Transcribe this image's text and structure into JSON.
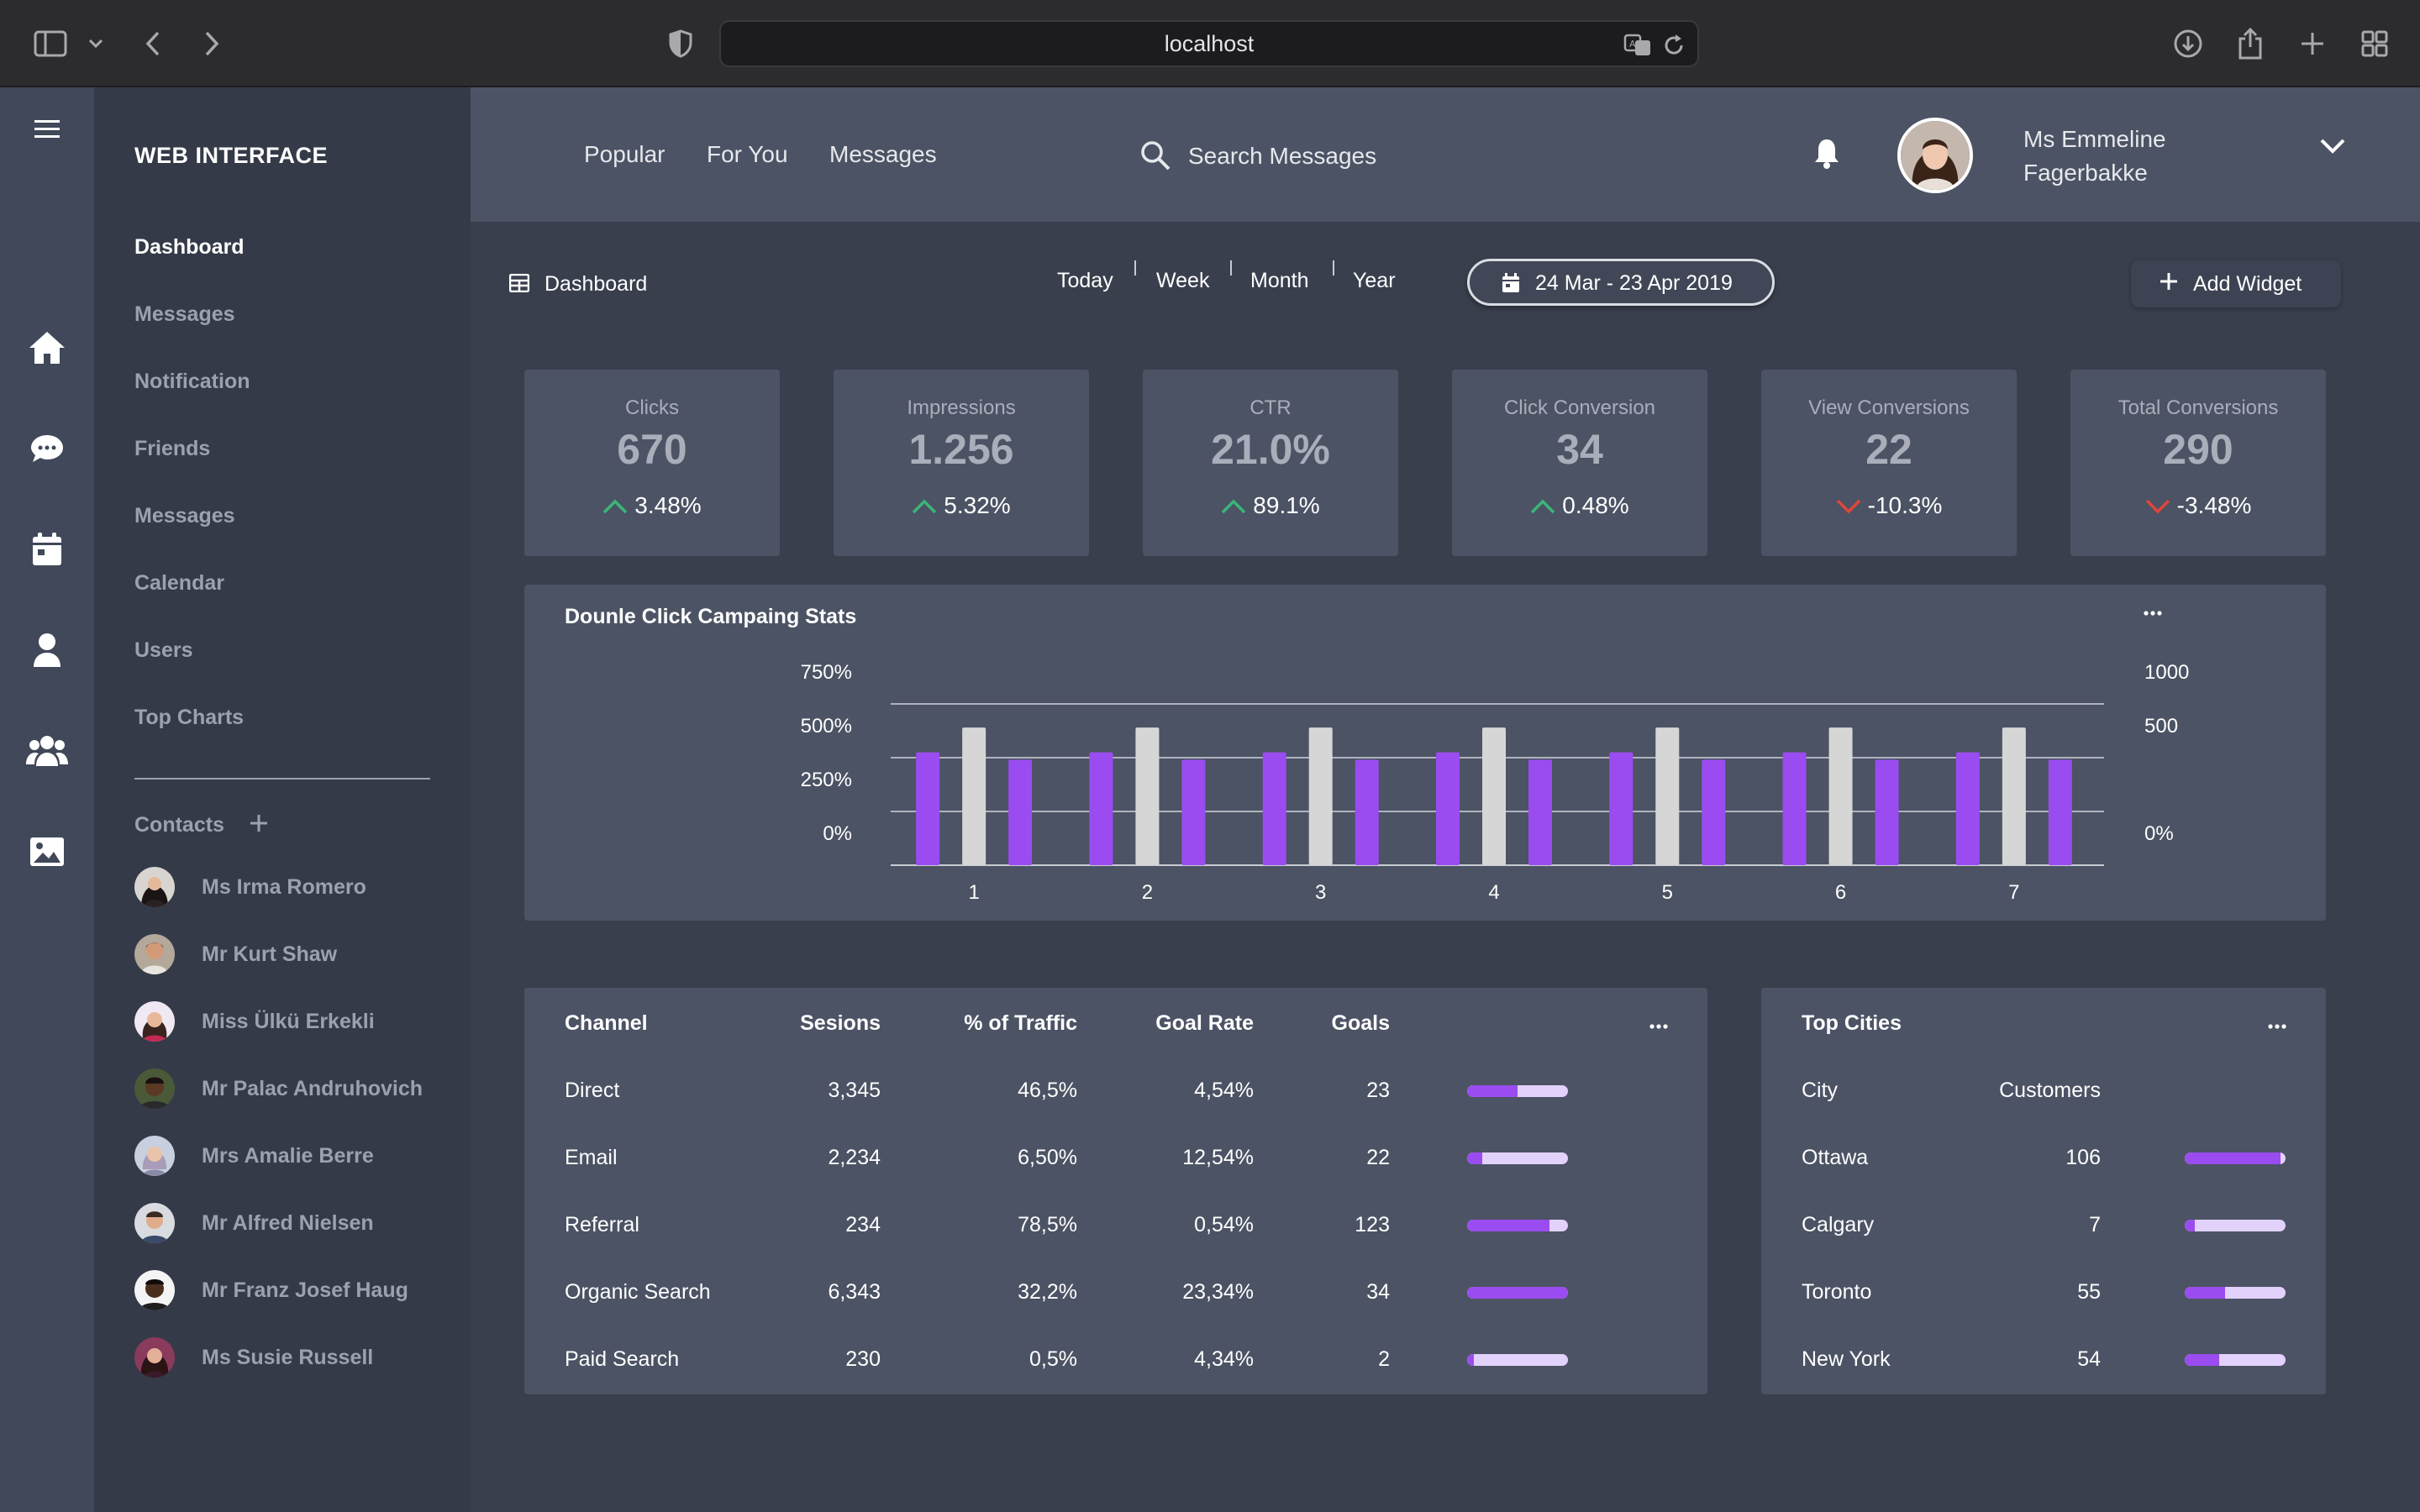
{
  "browser": {
    "url": "localhost"
  },
  "sidebar": {
    "brand": "WEB INTERFACE",
    "items": [
      {
        "label": "Dashboard",
        "active": true
      },
      {
        "label": "Messages"
      },
      {
        "label": "Notification"
      },
      {
        "label": "Friends"
      },
      {
        "label": "Messages"
      },
      {
        "label": "Calendar"
      },
      {
        "label": "Users"
      },
      {
        "label": "Top Charts"
      }
    ],
    "contacts_label": "Contacts",
    "contacts": [
      {
        "name": "Ms Irma Romero"
      },
      {
        "name": "Mr Kurt Shaw"
      },
      {
        "name": "Miss Ülkü Erkekli"
      },
      {
        "name": "Mr Palac Andruhovich"
      },
      {
        "name": "Mrs Amalie Berre"
      },
      {
        "name": "Mr Alfred Nielsen"
      },
      {
        "name": "Mr Franz Josef Haug"
      },
      {
        "name": "Ms Susie Russell"
      }
    ]
  },
  "rail_icons": [
    "home-icon",
    "chat-icon",
    "calendar-icon",
    "user-icon",
    "users-icon",
    "image-icon"
  ],
  "topbar": {
    "nav": [
      "Popular",
      "For You",
      "Messages"
    ],
    "search_placeholder": "Search Messages",
    "user": {
      "name_line1": "Ms Emmeline",
      "name_line2": "Fagerbakke"
    }
  },
  "dashboard": {
    "title": "Dashboard",
    "periods": [
      "Today",
      "Week",
      "Month",
      "Year"
    ],
    "date_range": "24 Mar - 23 Apr 2019",
    "add_widget": "Add Widget"
  },
  "kpis": [
    {
      "label": "Clicks",
      "value": "670",
      "change": "3.48%",
      "trend": "up"
    },
    {
      "label": "Impressions",
      "value": "1.256",
      "change": "5.32%",
      "trend": "up"
    },
    {
      "label": "CTR",
      "value": "21.0%",
      "change": "89.1%",
      "trend": "up"
    },
    {
      "label": "Click Conversion",
      "value": "34",
      "change": "0.48%",
      "trend": "up"
    },
    {
      "label": "View Conversions",
      "value": "22",
      "change": "-10.3%",
      "trend": "down"
    },
    {
      "label": "Total Conversions",
      "value": "290",
      "change": "-3.48%",
      "trend": "down"
    }
  ],
  "colors": {
    "accent": "#9a4cf0",
    "bar_light": "#d6d6d6",
    "bar_track": "#e2d2fb",
    "up": "#3bb57a",
    "down": "#e0453a"
  },
  "chart_data": {
    "type": "bar",
    "title": "Dounle Click Campaing Stats",
    "categories": [
      "1",
      "2",
      "3",
      "4",
      "5",
      "6",
      "7"
    ],
    "y_left_ticks": [
      "750%",
      "500%",
      "250%",
      "0%"
    ],
    "y_right_ticks": [
      "1000",
      "500",
      "0%"
    ],
    "ylim": [
      0,
      750
    ],
    "grid": true,
    "series": [
      {
        "values": [
          525,
          525,
          525,
          525,
          525,
          525,
          525
        ]
      },
      {
        "values": [
          640,
          640,
          640,
          640,
          640,
          640,
          640
        ]
      },
      {
        "values": [
          490,
          490,
          490,
          490,
          490,
          490,
          490
        ]
      }
    ]
  },
  "channels": {
    "headers": [
      "Channel",
      "Sesions",
      "% of Traffic",
      "Goal Rate",
      "Goals"
    ],
    "rows": [
      {
        "channel": "Direct",
        "sessions": "3,345",
        "traffic": "46,5%",
        "goal_rate": "4,54%",
        "goals": "23",
        "progress": 0.5
      },
      {
        "channel": "Email",
        "sessions": "2,234",
        "traffic": "6,50%",
        "goal_rate": "12,54%",
        "goals": "22",
        "progress": 0.15
      },
      {
        "channel": "Referral",
        "sessions": "234",
        "traffic": "78,5%",
        "goal_rate": "0,54%",
        "goals": "123",
        "progress": 0.82
      },
      {
        "channel": "Organic Search",
        "sessions": "6,343",
        "traffic": "32,2%",
        "goal_rate": "23,34%",
        "goals": "34",
        "progress": 1.0
      },
      {
        "channel": "Paid Search",
        "sessions": "230",
        "traffic": "0,5%",
        "goal_rate": "4,34%",
        "goals": "2",
        "progress": 0.07
      }
    ]
  },
  "cities": {
    "title": "Top Cities",
    "headers": [
      "City",
      "Customers"
    ],
    "rows": [
      {
        "city": "Ottawa",
        "customers": "106",
        "progress": 0.95
      },
      {
        "city": "Calgary",
        "customers": "7",
        "progress": 0.1
      },
      {
        "city": "Toronto",
        "customers": "55",
        "progress": 0.4
      },
      {
        "city": "New York",
        "customers": "54",
        "progress": 0.34
      }
    ]
  }
}
